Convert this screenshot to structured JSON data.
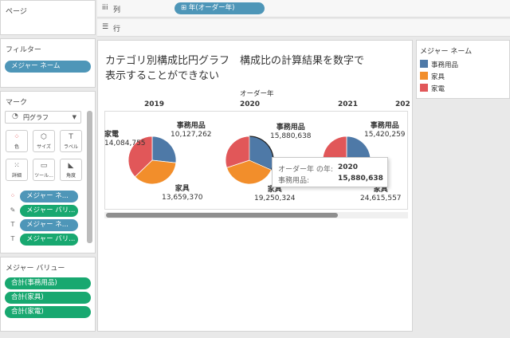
{
  "pages_panel": {
    "title": "ページ"
  },
  "columns_shelf": {
    "label": "列",
    "pill": "年(オーダー年)"
  },
  "rows_shelf": {
    "label": "行"
  },
  "filters": {
    "title": "フィルター",
    "pill": "メジャー ネーム"
  },
  "marks": {
    "title": "マーク",
    "mark_type": "円グラフ",
    "buttons": [
      "色",
      "サイズ",
      "ラベル",
      "詳細",
      "ツール...",
      "角度"
    ],
    "pills": [
      "メジャー ネ...",
      "メジャー バリ...",
      "メジャー ネ...",
      "メジャー バリ..."
    ]
  },
  "measure_values": {
    "title": "メジャー バリュー",
    "pills": [
      "合計(事務用品)",
      "合計(家具)",
      "合計(家電)"
    ]
  },
  "view": {
    "title_line1": "カテゴリ別構成比円グラフ　構成比の計算結果を数字で",
    "title_line2": "表示することができない",
    "header": "オーダー年"
  },
  "legend": {
    "title": "メジャー ネーム",
    "items": [
      {
        "label": "事務用品",
        "color": "#4e79a7"
      },
      {
        "label": "家具",
        "color": "#f28e2b"
      },
      {
        "label": "家電",
        "color": "#e15759"
      }
    ]
  },
  "tooltip": {
    "line1_label": "オーダー年 の年:",
    "line1_value": "2020",
    "line2_label": "事務用品:",
    "line2_value": "15,880,638"
  },
  "chart_data": {
    "type": "pie",
    "categories": [
      "事務用品",
      "家具",
      "家電"
    ],
    "colors": [
      "#4e79a7",
      "#f28e2b",
      "#e15759"
    ],
    "years": [
      {
        "year": "2019",
        "values": [
          10127262,
          13659370,
          14084755
        ],
        "labels": [
          "10,127,262",
          "13,659,370",
          "14,084,755"
        ]
      },
      {
        "year": "2020",
        "values": [
          15880638,
          19250324,
          15100000
        ],
        "labels": [
          "15,880,638",
          "19,250,324"
        ]
      },
      {
        "year": "2021",
        "values": [
          15420259,
          24615557,
          16000000
        ],
        "labels": [
          "15,420,259",
          "24,615,557"
        ]
      },
      {
        "year": "202"
      }
    ]
  }
}
